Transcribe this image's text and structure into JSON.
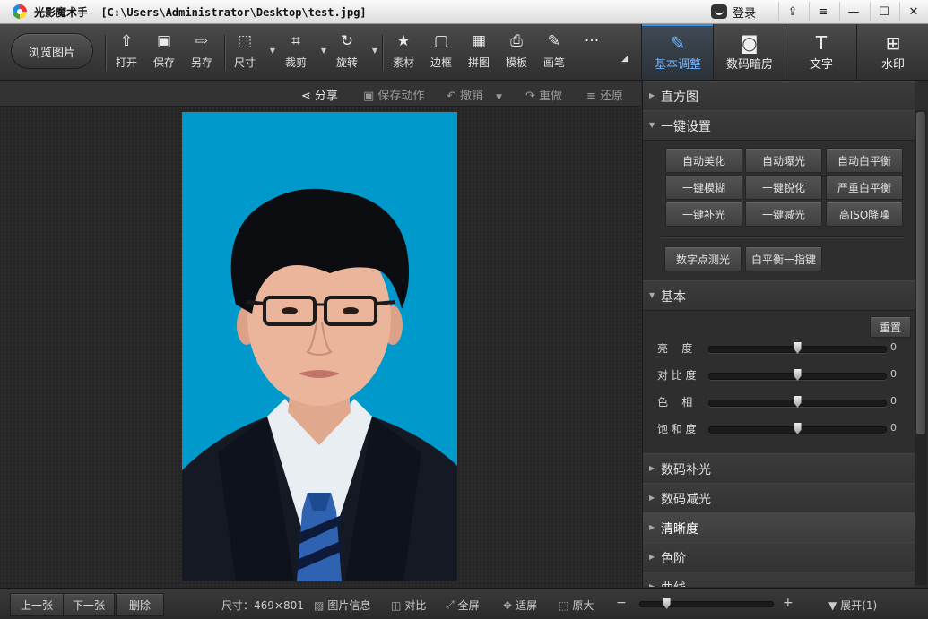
{
  "window": {
    "title": "光影魔术手  [C:\\Users\\Administrator\\Desktop\\test.jpg]",
    "login_label": "登录",
    "buttons": [
      "⇪",
      "≡",
      "—",
      "☐",
      "✕"
    ]
  },
  "toolbar": {
    "browse_label": "浏览图片",
    "tools": [
      {
        "label": "打开",
        "icon": "open-icon",
        "glyph": "⇧"
      },
      {
        "label": "保存",
        "icon": "save-icon",
        "glyph": "▣"
      },
      {
        "label": "另存",
        "icon": "save-as-icon",
        "glyph": "⇨"
      },
      {
        "label": "尺寸",
        "icon": "resize-icon",
        "glyph": "⬚"
      },
      {
        "label": "裁剪",
        "icon": "crop-icon",
        "glyph": "⌗"
      },
      {
        "label": "旋转",
        "icon": "rotate-icon",
        "glyph": "↻"
      },
      {
        "label": "素材",
        "icon": "material-icon",
        "glyph": "★"
      },
      {
        "label": "边框",
        "icon": "border-icon",
        "glyph": "▢"
      },
      {
        "label": "拼图",
        "icon": "collage-icon",
        "glyph": "▦"
      },
      {
        "label": "模板",
        "icon": "template-icon",
        "glyph": "⎙"
      },
      {
        "label": "画笔",
        "icon": "brush-icon",
        "glyph": "✎"
      }
    ],
    "more": "···",
    "right_tabs": [
      {
        "label": "基本调整",
        "icon": "basic-adjust-icon",
        "glyph": "✎"
      },
      {
        "label": "数码暗房",
        "icon": "darkroom-icon",
        "glyph": "◙"
      },
      {
        "label": "文字",
        "icon": "text-icon",
        "glyph": "T"
      },
      {
        "label": "水印",
        "icon": "watermark-icon",
        "glyph": "⊞"
      }
    ]
  },
  "subbar": {
    "share": "分享",
    "save_action": "保存动作",
    "undo": "撤销",
    "redo": "重做",
    "restore": "还原"
  },
  "panel": {
    "histogram": "直方图",
    "one_click": "一键设置",
    "one_click_buttons": [
      "自动美化",
      "自动曝光",
      "自动白平衡",
      "一键模糊",
      "一键锐化",
      "严重白平衡",
      "一键补光",
      "一键减光",
      "高ISO降噪"
    ],
    "extra_buttons": [
      "数字点测光",
      "白平衡一指键"
    ],
    "basic": "基本",
    "reset": "重置",
    "sliders": [
      {
        "label": "亮    度",
        "value": "0",
        "level": 0.5
      },
      {
        "label": "对 比 度",
        "value": "0",
        "level": 0.5
      },
      {
        "label": "色    相",
        "value": "0",
        "level": 0.5
      },
      {
        "label": "饱 和 度",
        "value": "0",
        "level": 0.5
      }
    ],
    "sections": [
      "数码补光",
      "数码减光",
      "清晰度",
      "色阶",
      "曲线"
    ]
  },
  "status": {
    "prev": "上一张",
    "next": "下一张",
    "delete": "删除",
    "size": "尺寸：469×801",
    "info": "图片信息",
    "compare": "对比",
    "fullscreen": "全屏",
    "fit": "适屏",
    "original": "原大",
    "minus": "−",
    "plus": "+",
    "zoom_level": 0.2,
    "expand": "展开(1)"
  },
  "colors": {
    "photo_bg": "#0099cc",
    "accent": "#3d8fe0"
  }
}
